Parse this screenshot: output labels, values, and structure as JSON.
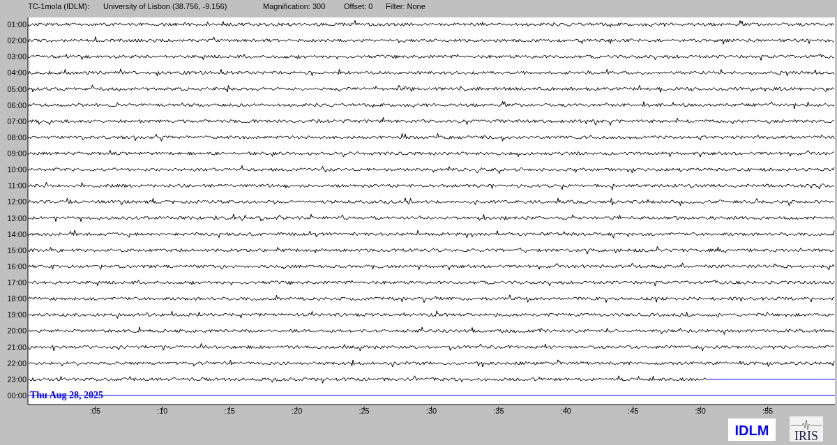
{
  "header": {
    "station": "TC-1mola (IDLM):",
    "location": "University of Lisbon (38.756, -9.156)",
    "magnification": "Magnification: 300",
    "offset": "Offset: 0",
    "filter": "Filter: None"
  },
  "helicorder": {
    "rows": [
      {
        "label": "01:00",
        "kind": "trace"
      },
      {
        "label": "02:00",
        "kind": "trace"
      },
      {
        "label": "03:00",
        "kind": "trace"
      },
      {
        "label": "04:00",
        "kind": "trace"
      },
      {
        "label": "05:00",
        "kind": "trace"
      },
      {
        "label": "06:00",
        "kind": "trace"
      },
      {
        "label": "07:00",
        "kind": "trace"
      },
      {
        "label": "08:00",
        "kind": "trace"
      },
      {
        "label": "09:00",
        "kind": "trace"
      },
      {
        "label": "10:00",
        "kind": "trace"
      },
      {
        "label": "11:00",
        "kind": "trace"
      },
      {
        "label": "12:00",
        "kind": "trace"
      },
      {
        "label": "13:00",
        "kind": "trace"
      },
      {
        "label": "14:00",
        "kind": "trace"
      },
      {
        "label": "15:00",
        "kind": "trace"
      },
      {
        "label": "16:00",
        "kind": "trace"
      },
      {
        "label": "17:00",
        "kind": "trace"
      },
      {
        "label": "18:00",
        "kind": "trace"
      },
      {
        "label": "19:00",
        "kind": "trace"
      },
      {
        "label": "20:00",
        "kind": "trace"
      },
      {
        "label": "21:00",
        "kind": "trace"
      },
      {
        "label": "22:00",
        "kind": "trace"
      },
      {
        "label": "23:00",
        "kind": "partial"
      },
      {
        "label": "00:00",
        "kind": "empty"
      }
    ],
    "date": "Thu Aug 28, 2025",
    "minute_ticks": [
      ":05",
      ":10",
      ":15",
      ":20",
      ":25",
      ":30",
      ":35",
      ":40",
      ":45",
      ":50",
      ":55"
    ]
  },
  "logos": [
    {
      "text": "IDLM",
      "kind": "text-logo"
    },
    {
      "text": "IRIS",
      "kind": "seismo-logo"
    }
  ]
}
